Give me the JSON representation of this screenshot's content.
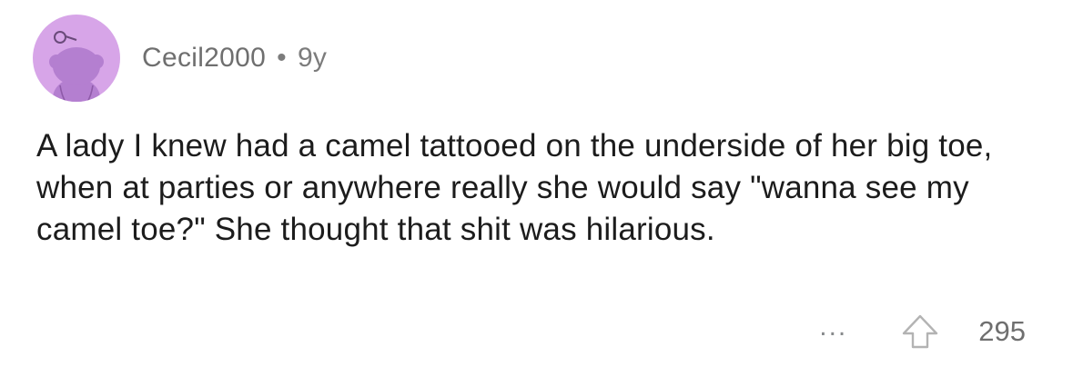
{
  "comment": {
    "username": "Cecil2000",
    "separator": "•",
    "age": "9y",
    "body": "A lady I knew had a camel tattooed on the underside of her big toe, when at parties or anywhere really she would say \"wanna see my camel toe?\" She thought that shit was hilarious.",
    "more_label": "...",
    "score": "295"
  },
  "colors": {
    "avatar_bg": "#d7a5e8",
    "avatar_figure": "#b47fd0",
    "meta_text": "#7c7c7c",
    "body_text": "#1c1c1c"
  },
  "icons": {
    "avatar": "snoo-avatar-icon",
    "more": "more-options-icon",
    "upvote": "upvote-arrow-icon"
  }
}
